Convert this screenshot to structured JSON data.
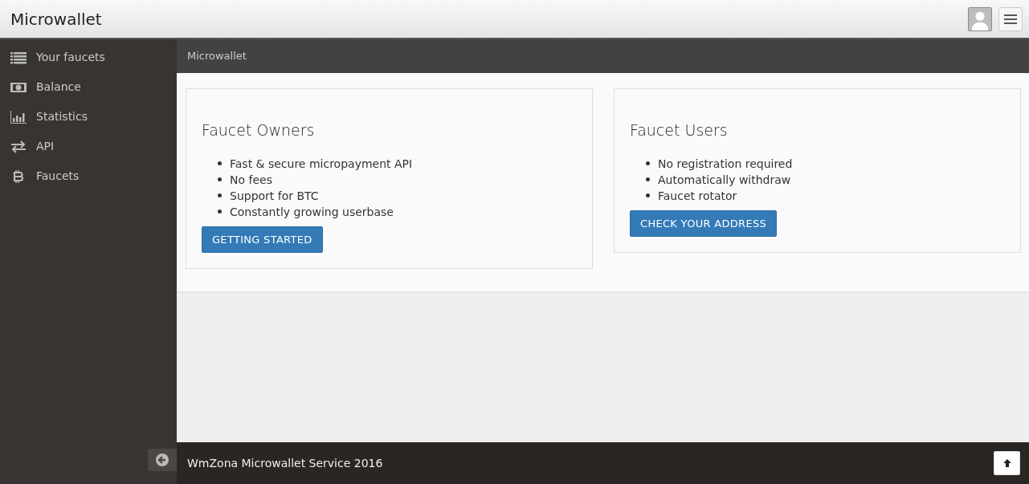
{
  "navbar": {
    "brand": "Microwallet"
  },
  "sidebar": {
    "items": [
      {
        "label": "Your faucets"
      },
      {
        "label": "Balance"
      },
      {
        "label": "Statistics"
      },
      {
        "label": "API"
      },
      {
        "label": "Faucets"
      }
    ]
  },
  "breadcrumb": "Microwallet",
  "cards": [
    {
      "title": "Faucet Owners",
      "features": [
        "Fast & secure micropayment API",
        "No fees",
        "Support for BTC",
        "Constantly growing userbase"
      ],
      "button": "GETTING STARTED"
    },
    {
      "title": "Faucet Users",
      "features": [
        "No registration required",
        "Automatically withdraw",
        "Faucet rotator"
      ],
      "button": "CHECK YOUR ADDRESS"
    }
  ],
  "footer": {
    "text": "WmZona Microwallet Service 2016"
  }
}
